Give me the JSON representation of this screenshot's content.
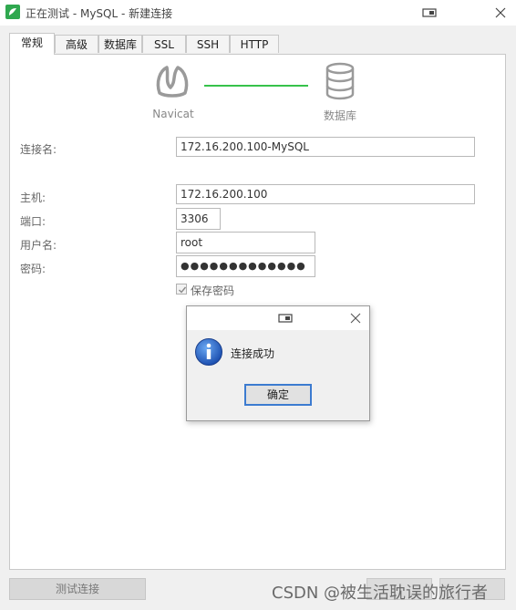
{
  "window": {
    "title": "正在测试 - MySQL - 新建连接"
  },
  "tabs": [
    {
      "label": "常规",
      "active": true
    },
    {
      "label": "高级"
    },
    {
      "label": "数据库"
    },
    {
      "label": "SSL"
    },
    {
      "label": "SSH"
    },
    {
      "label": "HTTP"
    }
  ],
  "header": {
    "left_label": "Navicat",
    "right_label": "数据库",
    "line_color": "#37c24b"
  },
  "form": {
    "connection_name_label": "连接名:",
    "connection_name_value": "172.16.200.100-MySQL",
    "host_label": "主机:",
    "host_value": "172.16.200.100",
    "port_label": "端口:",
    "port_value": "3306",
    "user_label": "用户名:",
    "user_value": "root",
    "password_label": "密码:",
    "password_value": "●●●●●●●●●●●●●",
    "save_password_label": "保存密码",
    "save_password_checked": true
  },
  "bottom": {
    "test_button_label": "测试连接",
    "watermark": "CSDN @被生活耽误的旅行者"
  },
  "dialog": {
    "message": "连接成功",
    "ok_label": "确定",
    "icon": "info-icon"
  },
  "colors": {
    "accent_blue": "#3c7bd0",
    "app_green": "#2fa84f"
  }
}
